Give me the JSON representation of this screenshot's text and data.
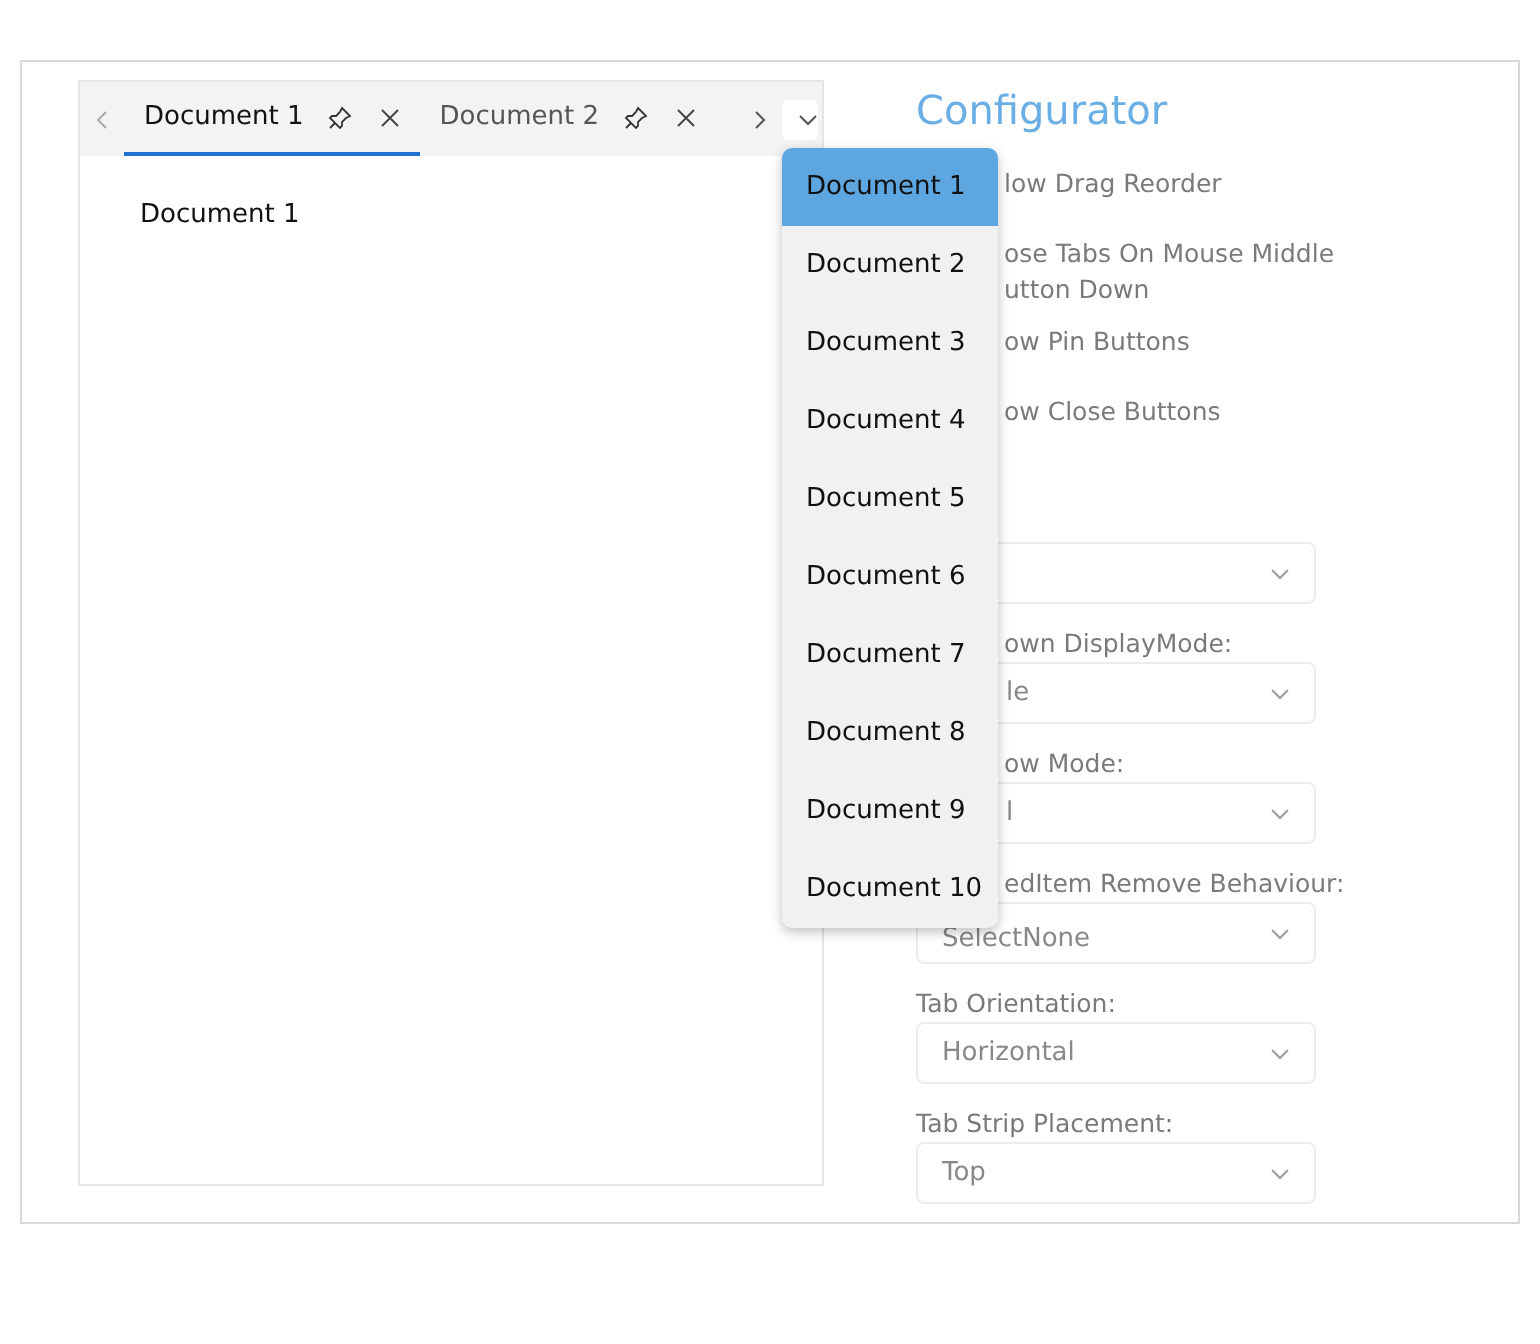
{
  "tabs": [
    {
      "label": "Document 1",
      "selected": true
    },
    {
      "label": "Document 2",
      "selected": false
    }
  ],
  "content_text": "Document 1",
  "overflow_menu": [
    {
      "label": "Document 1",
      "selected": true
    },
    {
      "label": "Document 2",
      "selected": false
    },
    {
      "label": "Document 3",
      "selected": false
    },
    {
      "label": "Document 4",
      "selected": false
    },
    {
      "label": "Document 5",
      "selected": false
    },
    {
      "label": "Document 6",
      "selected": false
    },
    {
      "label": "Document 7",
      "selected": false
    },
    {
      "label": "Document 8",
      "selected": false
    },
    {
      "label": "Document 9",
      "selected": false
    },
    {
      "label": "Document 10",
      "selected": false
    }
  ],
  "configurator": {
    "title": "Configurator",
    "options": [
      {
        "kind": "check",
        "lines": [
          "low Drag Reorder"
        ]
      },
      {
        "kind": "check",
        "lines": [
          "ose Tabs On Mouse Middle",
          "utton Down"
        ]
      },
      {
        "kind": "check",
        "lines": [
          "ow Pin Buttons"
        ]
      },
      {
        "kind": "check",
        "lines": [
          "ow Close Buttons"
        ]
      },
      {
        "kind": "covered_combo"
      },
      {
        "kind": "covered_combo",
        "label": "own DisplayMode:",
        "value": "le"
      },
      {
        "kind": "covered_combo",
        "label": "ow Mode:",
        "value": "l"
      },
      {
        "kind": "half_combo",
        "label": "edItem Remove Behaviour:",
        "value": "SelectNone"
      },
      {
        "kind": "combo",
        "label": "Tab Orientation:",
        "value": "Horizontal"
      },
      {
        "kind": "combo",
        "label": "Tab Strip Placement:",
        "value": "Top"
      }
    ]
  }
}
